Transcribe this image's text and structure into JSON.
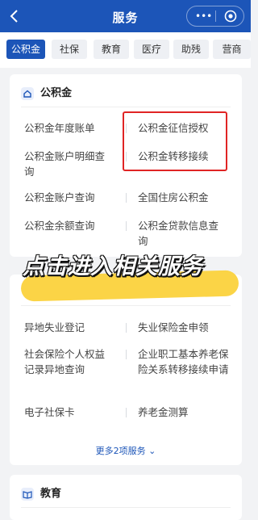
{
  "header": {
    "title": "服务",
    "more_dots": "•••"
  },
  "tabs": [
    {
      "label": "公积金",
      "active": true
    },
    {
      "label": "社保",
      "active": false
    },
    {
      "label": "教育",
      "active": false
    },
    {
      "label": "医疗",
      "active": false
    },
    {
      "label": "助残",
      "active": false
    },
    {
      "label": "营商",
      "active": false
    }
  ],
  "gjj": {
    "title": "公积金",
    "items": [
      "公积金年度账单",
      "公积金征信授权",
      "公积金账户明细查询",
      "公积金转移接续",
      "公积金账户查询",
      "全国住房公积金",
      "公积金余额查询",
      "公积金贷款信息查询"
    ]
  },
  "banner": "点击进入相关服务",
  "social": {
    "items": [
      "异地失业登记",
      "失业保险金申领",
      "社会保险个人权益记录异地查询",
      "企业职工基本养老保险关系转移接续申请",
      "电子社保卡",
      "养老金测算"
    ],
    "more": "更多2项服务",
    "more_chevron": "⌄"
  },
  "edu": {
    "title": "教育"
  },
  "colors": {
    "brand": "#1c55b8",
    "highlight": "#e02424",
    "banner_bg": "#fbd446"
  }
}
